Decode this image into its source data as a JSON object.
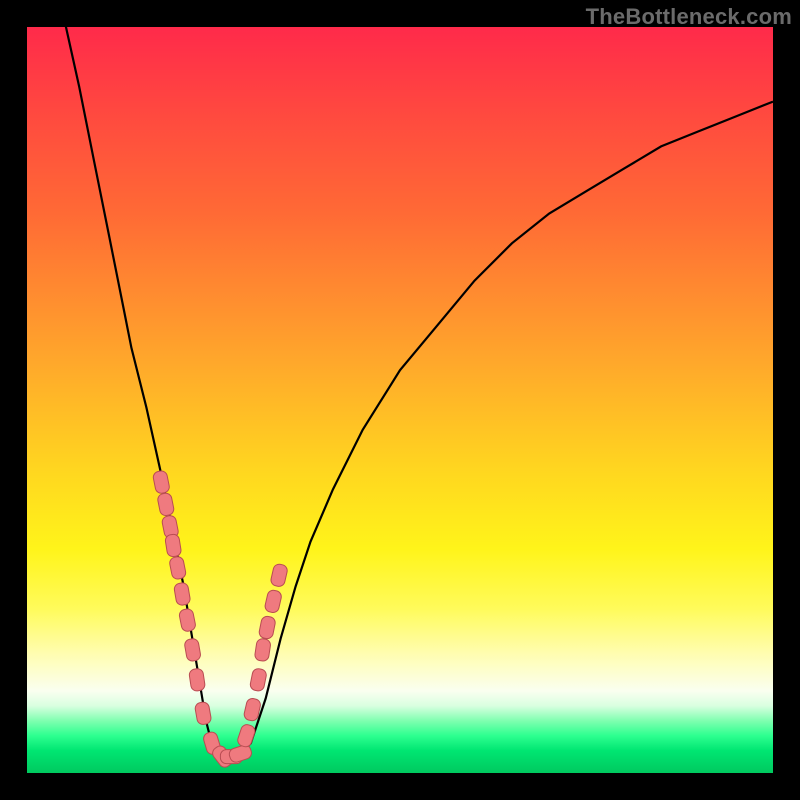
{
  "watermark": "TheBottleneck.com",
  "colors": {
    "marker_fill": "#ef7a7f",
    "marker_stroke": "#b94c52",
    "curve_color": "#000000"
  },
  "chart_data": {
    "type": "line",
    "title": "",
    "xlabel": "",
    "ylabel": "",
    "xlim": [
      0,
      100
    ],
    "ylim": [
      0,
      100
    ],
    "grid": false,
    "series": [
      {
        "name": "curve",
        "x": [
          5,
          7,
          9,
          11,
          13,
          14,
          16,
          18,
          20,
          21,
          22,
          23,
          24,
          25,
          26,
          28,
          30,
          32,
          34,
          36,
          38,
          41,
          45,
          50,
          55,
          60,
          65,
          70,
          75,
          80,
          85,
          90,
          95,
          100
        ],
        "y": [
          101,
          92,
          82,
          72,
          62,
          57,
          49,
          40,
          30,
          25,
          19,
          13,
          7,
          3,
          2,
          2,
          4,
          10,
          18,
          25,
          31,
          38,
          46,
          54,
          60,
          66,
          71,
          75,
          78,
          81,
          84,
          86,
          88,
          90
        ]
      }
    ],
    "markers": {
      "name": "points",
      "x": [
        18.0,
        18.6,
        19.2,
        19.6,
        20.2,
        20.8,
        21.5,
        22.2,
        22.8,
        23.6,
        24.8,
        26.2,
        27.4,
        28.6,
        29.4,
        30.2,
        31.0,
        31.6,
        32.2,
        33.0,
        33.8
      ],
      "y": [
        39.0,
        36.0,
        33.0,
        30.5,
        27.5,
        24.0,
        20.5,
        16.5,
        12.5,
        8.0,
        4.0,
        2.2,
        2.2,
        2.6,
        5.0,
        8.5,
        12.5,
        16.5,
        19.5,
        23.0,
        26.5
      ]
    }
  }
}
